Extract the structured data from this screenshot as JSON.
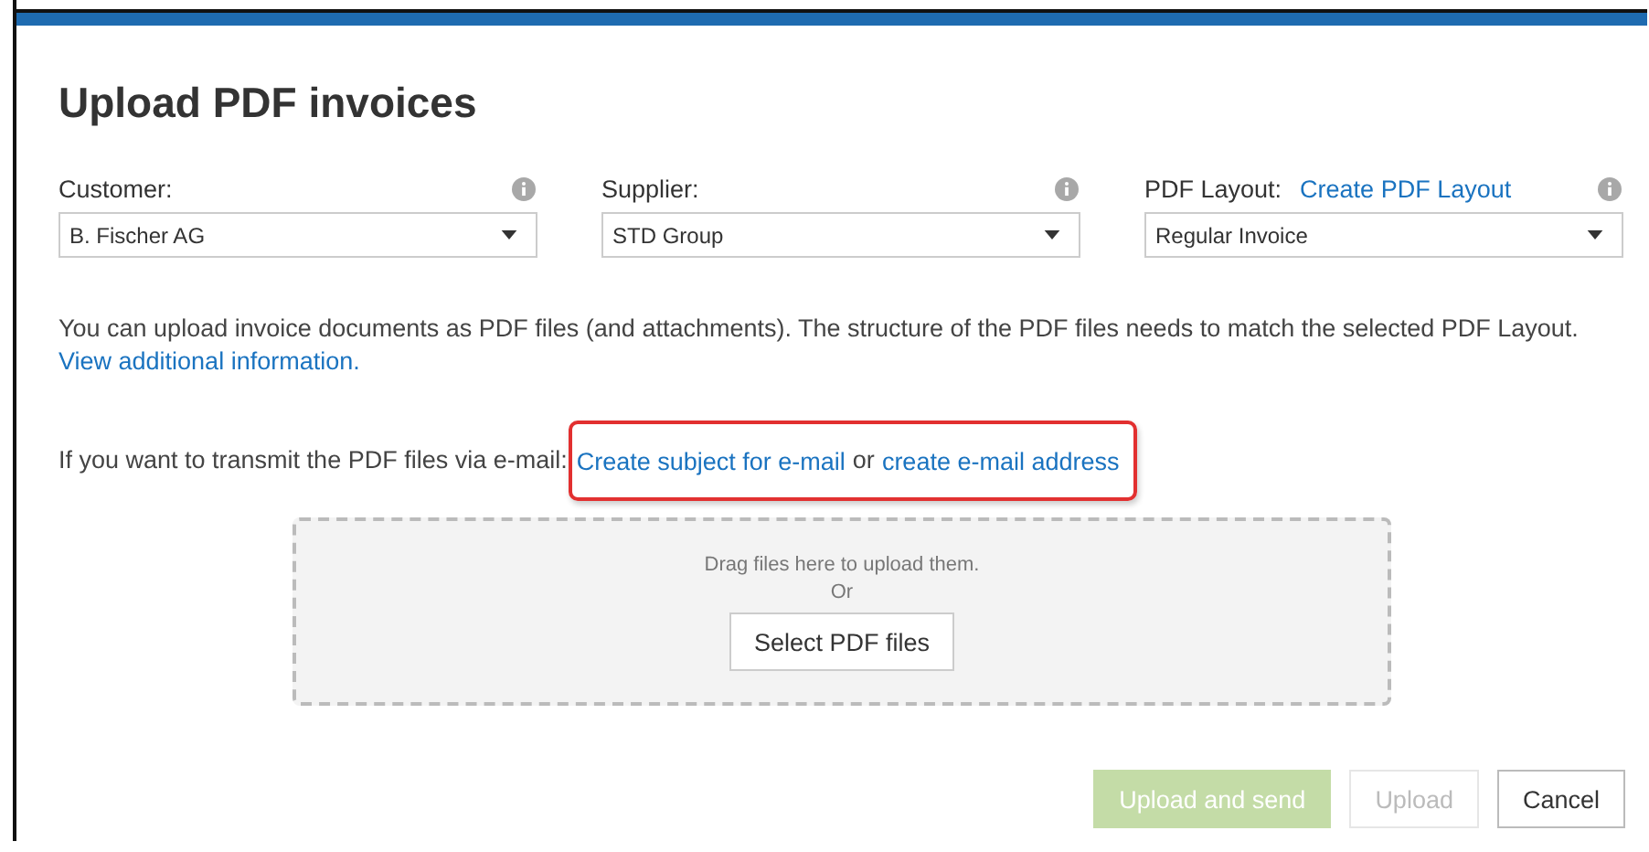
{
  "dialog": {
    "title": "Upload PDF invoices"
  },
  "fields": [
    {
      "label": "Customer:",
      "value": "B. Fischer AG"
    },
    {
      "label": "Supplier:",
      "value": "STD Group"
    },
    {
      "label": "PDF Layout:",
      "link": "Create PDF Layout",
      "value": "Regular Invoice"
    }
  ],
  "info": {
    "text": "You can upload invoice documents as PDF files (and attachments). The structure of the PDF files needs to match the selected PDF Layout.",
    "link": "View additional information."
  },
  "email": {
    "text": "If you want to transmit the PDF files via e-mail:",
    "link_1": "Create subject for e-mail",
    "joiner": "or",
    "link_2": "create e-mail address",
    "highlighted": true
  },
  "dropzone": {
    "hint": "Drag files here to upload them.",
    "or": "Or",
    "button": "Select PDF files"
  },
  "buttons": [
    {
      "label": "Upload and send",
      "kind": "primary",
      "disabled": true
    },
    {
      "label": "Upload",
      "kind": "secondary",
      "disabled": true
    },
    {
      "label": "Cancel",
      "kind": "secondary",
      "disabled": false
    }
  ]
}
